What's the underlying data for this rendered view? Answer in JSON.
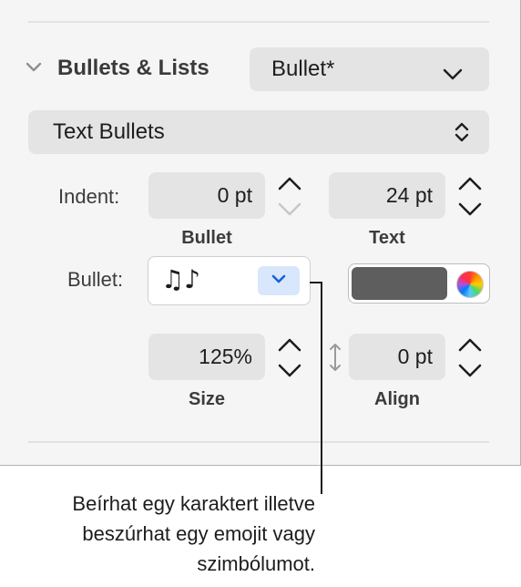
{
  "section": {
    "title": "Bullets & Lists",
    "style_popup": "Bullet*"
  },
  "list_type": "Text Bullets",
  "indent": {
    "label": "Indent:",
    "bullet_value": "0 pt",
    "bullet_sublabel": "Bullet",
    "text_value": "24 pt",
    "text_sublabel": "Text"
  },
  "bullet": {
    "label": "Bullet:",
    "character": "♫♪",
    "color": "#5e5e5e"
  },
  "size": {
    "value": "125%",
    "sublabel": "Size"
  },
  "align": {
    "value": "0 pt",
    "sublabel": "Align"
  },
  "callout": {
    "line1": "Beírhat egy karaktert illetve",
    "line2": "beszúrhat egy emojit vagy",
    "line3": "szimbólumot."
  },
  "icons": [
    "disclosure-chevron-icon",
    "chevron-down-icon",
    "up-down-chevron-icon",
    "stepper-icon",
    "vertical-resize-icon",
    "color-wheel-icon"
  ]
}
